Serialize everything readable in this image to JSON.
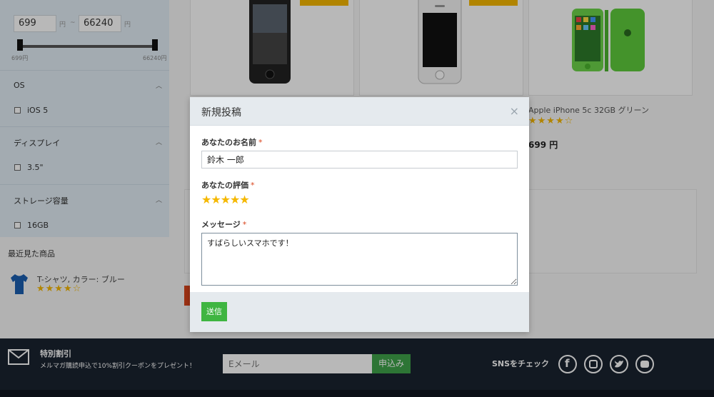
{
  "filter": {
    "price_min": "699",
    "price_max": "66240",
    "yen": "円",
    "dash": "~",
    "slider_min_label": "699円",
    "slider_max_label": "66240円",
    "os_title": "OS",
    "os_option": "iOS 5",
    "display_title": "ディスプレイ",
    "display_option": "3.5\"",
    "storage_title": "ストレージ容量",
    "storage_option": "16GB"
  },
  "recent": {
    "title": "最近見た商品",
    "item_name": "T-シャツ, カラー: ブルー",
    "item_stars": "★★★★☆"
  },
  "product": {
    "name": "Apple iPhone 5c 32GB グリーン",
    "stars": "★★★★☆",
    "price": "699 円"
  },
  "modal": {
    "title": "新規投稿",
    "close": "×",
    "name_label": "あなたのお名前",
    "required_mark": "*",
    "name_value": "鈴木 一郎",
    "rating_label": "あなたの評価",
    "rating": 5,
    "rating_stars": "★★★★★",
    "message_label": "メッセージ",
    "message_value": "すばらしいスマホです！",
    "submit_label": "送信"
  },
  "footer": {
    "promo_title": "特別割引",
    "promo_desc": "メルマガ購読申込で10%割引クーポンをプレゼント！",
    "email_placeholder": "Eメール",
    "subscribe_label": "申込み",
    "sns_label": "SNSをチェック",
    "sns_icons": [
      "facebook-icon",
      "instagram-icon",
      "twitter-icon",
      "youtube-icon"
    ]
  },
  "colors": {
    "accent_green": "#3fb541",
    "star_yellow": "#f5b800",
    "footer_bg": "#1a2330",
    "required_red": "#d9441c"
  }
}
